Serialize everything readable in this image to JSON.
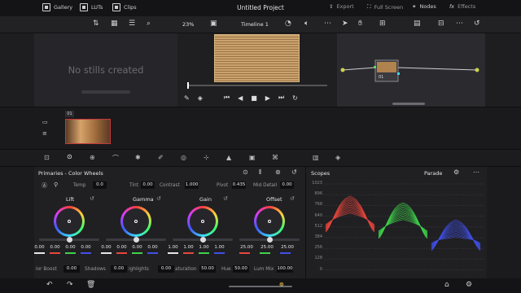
{
  "topbar": {
    "gallery": "Gallery",
    "luts": "LUTs",
    "clips": "Clips",
    "project_title": "Untitled Project",
    "export": "Export",
    "full_screen": "Full Screen",
    "nodes": "Nodes",
    "effects": "Effects"
  },
  "viewer": {
    "zoom": "23%",
    "timeline_name": "Timeline 1"
  },
  "gallery_panel": {
    "empty_text": "No stills created"
  },
  "node_graph": {
    "node_label": "01"
  },
  "timeline": {
    "clip_label": "01"
  },
  "primaries": {
    "title": "Primaries - Color Wheels",
    "top_params": [
      {
        "label": "Temp",
        "value": "0.0"
      },
      {
        "label": "Tint",
        "value": "0.00"
      },
      {
        "label": "Contrast",
        "value": "1.000"
      },
      {
        "label": "Pivot",
        "value": "0.435"
      },
      {
        "label": "Mid Detail",
        "value": "0.00"
      }
    ],
    "wheels": [
      {
        "name": "Lift",
        "values": [
          "0.00",
          "0.00",
          "0.00",
          "0.00"
        ]
      },
      {
        "name": "Gamma",
        "values": [
          "0.00",
          "0.00",
          "0.00",
          "0.00"
        ]
      },
      {
        "name": "Gain",
        "values": [
          "1.00",
          "1.00",
          "1.00",
          "1.00"
        ]
      },
      {
        "name": "Offset",
        "values": [
          "25.00",
          "25.00",
          "25.00"
        ]
      }
    ],
    "bottom_params": [
      {
        "label": "lor Boost",
        "value": "0.00"
      },
      {
        "label": "Shadows",
        "value": "0.00"
      },
      {
        "label": "ighlights",
        "value": "0.00"
      },
      {
        "label": "aturation",
        "value": "50.00"
      },
      {
        "label": "Hue",
        "value": "50.00"
      },
      {
        "label": "Lum Mix",
        "value": "100.00"
      }
    ]
  },
  "scopes": {
    "title": "Scopes",
    "mode": "Parade",
    "ticks": [
      "1023",
      "896",
      "768",
      "640",
      "512",
      "384",
      "256",
      "128",
      "0"
    ],
    "colors": {
      "red": "#e8453c",
      "green": "#3fd14a",
      "blue": "#4150e8"
    }
  }
}
